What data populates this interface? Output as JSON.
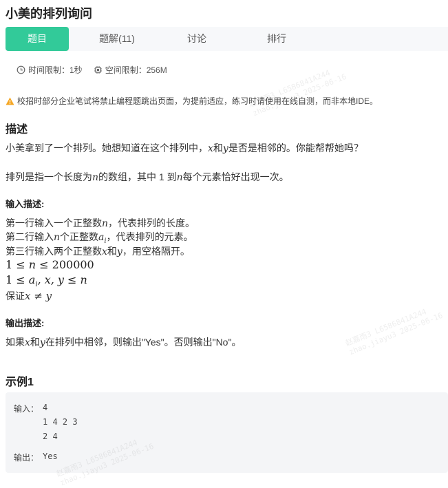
{
  "header": {
    "title": "小美的排列询问"
  },
  "tabs": [
    {
      "label": "题目",
      "active": true
    },
    {
      "label": "题解(11)",
      "active": false
    },
    {
      "label": "讨论",
      "active": false
    },
    {
      "label": "排行",
      "active": false
    }
  ],
  "limits": {
    "time": "时间限制：1秒",
    "space": "空间限制：256M"
  },
  "notice": "校招时部分企业笔试将禁止编程题跳出页面，为提前适应，练习时请使用在线自测，而非本地IDE。",
  "description": {
    "heading": "描述",
    "line1": {
      "a": "小美拿到了一个排列。她想知道在这个排列中，",
      "x": "x",
      "b": "和",
      "y": "y",
      "c": "是否是相邻的。你能帮帮她吗？"
    },
    "line2": {
      "a": "排列是指一个长度为",
      "n": "n",
      "b": "的数组，其中 1 到",
      "c": "每个元素恰好出现一次。"
    }
  },
  "input_desc": {
    "heading": "输入描述:",
    "line1": {
      "a": "第一行输入一个正整数",
      "v": "n",
      "b": "，代表排列的长度。"
    },
    "line2": {
      "a": "第二行输入",
      "v": "n",
      "b": "个正整数",
      "ai": "a",
      "sub": "i",
      "c": "，代表排列的元素。"
    },
    "line3": {
      "a": "第三行输入两个正整数",
      "x": "x",
      "b": "和",
      "y": "y",
      "c": "，用空格隔开。"
    },
    "math1": {
      "l": "1 ≤ ",
      "n": "n",
      "r": " ≤ 200000"
    },
    "math2": {
      "l": "1 ≤ ",
      "a": "a",
      "sub": "i",
      "rest": ", x, y ≤ n"
    },
    "guarantee": {
      "a": "保证",
      "expr": "x ≠ y"
    }
  },
  "output_desc": {
    "heading": "输出描述:",
    "line": {
      "a": "如果",
      "x": "x",
      "b": "和",
      "y": "y",
      "c": "在排列中相邻，则输出\"Yes\"。否则输出\"No\"。"
    }
  },
  "example": {
    "heading": "示例1",
    "input_label": "输入：",
    "input_lines": [
      "4",
      "1 4 2 3",
      "2 4"
    ],
    "output_label": "输出：",
    "output_value": "Yes"
  },
  "watermarks": [
    "赵嘉雨3 L6586841A244\nzhao.jiayu3 2025-06-16"
  ],
  "colors": {
    "accent": "#32ca99",
    "warning": "#f5a623"
  },
  "icons": {
    "time": "clock-icon",
    "space": "chip-icon",
    "notice": "warning-icon"
  }
}
